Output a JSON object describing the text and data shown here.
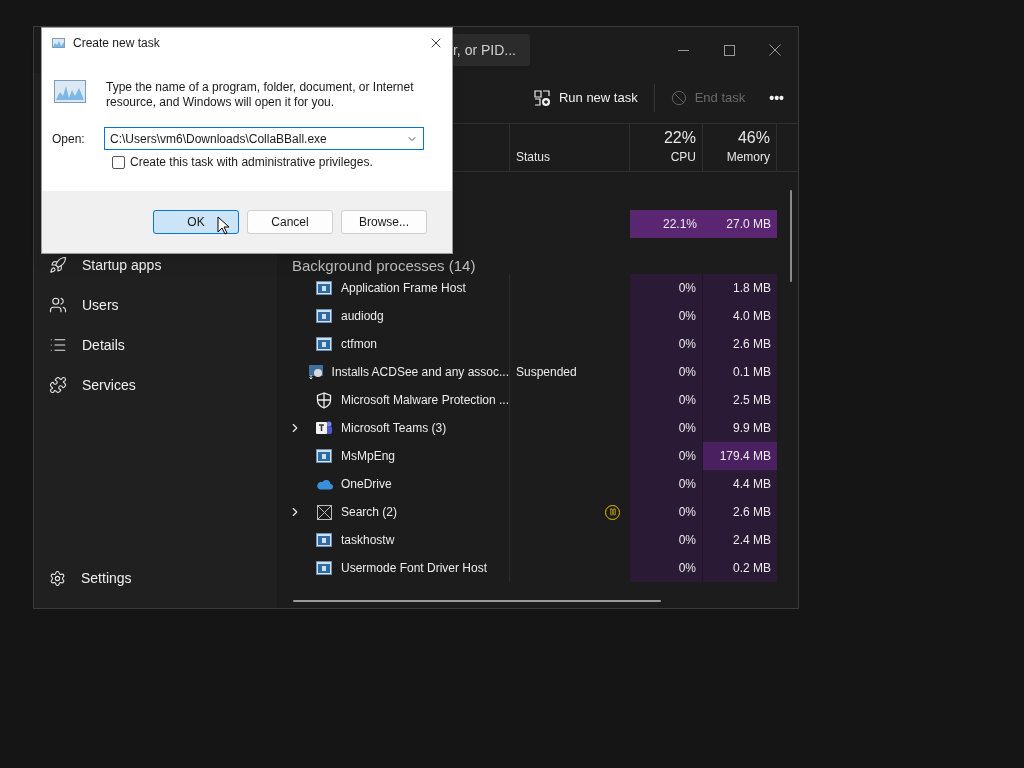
{
  "search": {
    "placeholder": "r, or PID..."
  },
  "sidebar": {
    "items": [
      {
        "label": "Startup apps",
        "kind": "startup"
      },
      {
        "label": "Users",
        "kind": "users"
      },
      {
        "label": "Details",
        "kind": "details"
      },
      {
        "label": "Services",
        "kind": "services"
      }
    ],
    "footer": {
      "label": "Settings"
    }
  },
  "toolbar": {
    "run": {
      "label": "Run new task",
      "disabled": false
    },
    "end": {
      "label": "End task",
      "disabled": true
    },
    "more": "•••"
  },
  "columns": {
    "status": "Status",
    "cpu": {
      "total": "22%",
      "label": "CPU"
    },
    "memory": {
      "total": "46%",
      "label": "Memory"
    }
  },
  "top_row": {
    "cpu": "22.1%",
    "memory": "27.0 MB",
    "cpu_hot": true,
    "memory_hot": true
  },
  "group": {
    "title": "Background processes (14)"
  },
  "rows": [
    {
      "name": "Application Frame Host",
      "kind": "window",
      "expandable": false,
      "paused": false,
      "cpu": "0%",
      "memory": "1.8 MB",
      "memory_hot": false
    },
    {
      "name": "audiodg",
      "kind": "window",
      "expandable": false,
      "paused": false,
      "cpu": "0%",
      "memory": "4.0 MB",
      "memory_hot": false
    },
    {
      "name": "ctfmon",
      "kind": "window",
      "expandable": false,
      "paused": false,
      "cpu": "0%",
      "memory": "2.6 MB",
      "memory_hot": false
    },
    {
      "name": "Installs ACDSee and any assoc...",
      "kind": "installer",
      "expandable": false,
      "status": "Suspended",
      "paused": false,
      "cpu": "0%",
      "memory": "0.1 MB",
      "memory_hot": false
    },
    {
      "name": "Microsoft Malware Protection ...",
      "kind": "shield",
      "expandable": false,
      "paused": false,
      "cpu": "0%",
      "memory": "2.5 MB",
      "memory_hot": false
    },
    {
      "name": "Microsoft Teams (3)",
      "kind": "teams",
      "expandable": true,
      "paused": false,
      "cpu": "0%",
      "memory": "9.9 MB",
      "memory_hot": false
    },
    {
      "name": "MsMpEng",
      "kind": "window",
      "expandable": false,
      "paused": false,
      "cpu": "0%",
      "memory": "179.4 MB",
      "memory_hot": true
    },
    {
      "name": "OneDrive",
      "kind": "cloud",
      "expandable": false,
      "paused": false,
      "cpu": "0%",
      "memory": "4.4 MB",
      "memory_hot": false
    },
    {
      "name": "Search (2)",
      "kind": "search",
      "expandable": true,
      "paused": true,
      "cpu": "0%",
      "memory": "2.6 MB",
      "memory_hot": false
    },
    {
      "name": "taskhostw",
      "kind": "window",
      "expandable": false,
      "paused": false,
      "cpu": "0%",
      "memory": "2.4 MB",
      "memory_hot": false
    },
    {
      "name": "Usermode Font Driver Host",
      "kind": "window",
      "expandable": false,
      "paused": false,
      "cpu": "0%",
      "memory": "0.2 MB",
      "memory_hot": false
    }
  ],
  "dialog": {
    "title": "Create new task",
    "description": "Type the name of a program, folder, document, or Internet resource, and Windows will open it for you.",
    "open_label": "Open:",
    "open_value": "C:\\Users\\vm6\\Downloads\\CollaBBall.exe",
    "admin": {
      "label": "Create this task with administrative privileges.",
      "checked": false
    },
    "buttons": [
      {
        "label": "OK",
        "default": true
      },
      {
        "label": "Cancel",
        "default": false
      },
      {
        "label": "Browse...",
        "default": false
      }
    ]
  }
}
